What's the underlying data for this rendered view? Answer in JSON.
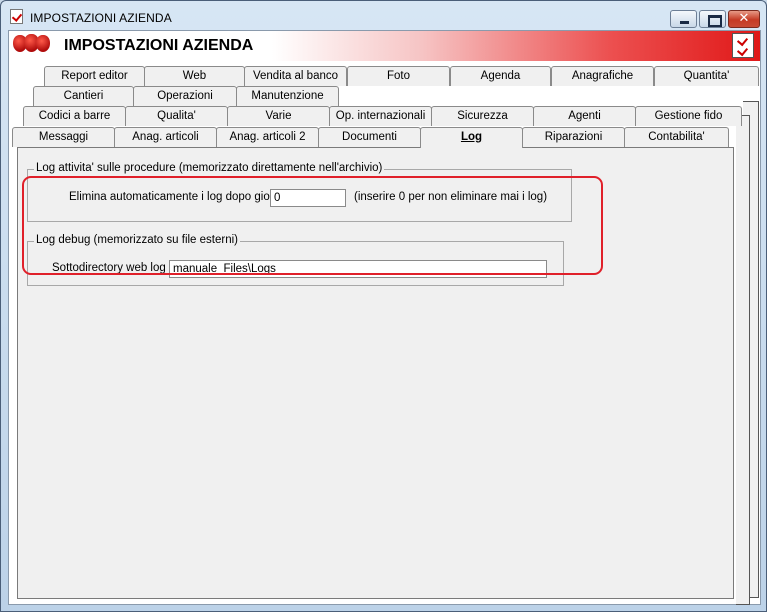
{
  "window": {
    "title": "IMPOSTAZIONI AZIENDA"
  },
  "banner": {
    "title": "IMPOSTAZIONI AZIENDA"
  },
  "tabs": {
    "row1": [
      "Report editor",
      "Web",
      "Vendita al banco",
      "Foto",
      "Agenda",
      "Anagrafiche",
      "Quantita'"
    ],
    "row2": [
      "Cantieri",
      "Operazioni",
      "Manutenzione"
    ],
    "row3": [
      "Codici a barre",
      "Qualita'",
      "Varie",
      "Op. internazionali",
      "Sicurezza",
      "Agenti",
      "Gestione fido"
    ],
    "row4": [
      "Messaggi",
      "Anag. articoli",
      "Anag. articoli 2",
      "Documenti",
      "Log",
      "Riparazioni",
      "Contabilita'"
    ],
    "active": "Log"
  },
  "log_group": {
    "legend": "Log attivita' sulle procedure (memorizzato direttamente nell'archivio)",
    "days_label": "Elimina automaticamente i log dopo giorni",
    "days_value": "0",
    "days_hint": "(inserire 0 per non eliminare mai i log)"
  },
  "debug_group": {
    "legend": "Log debug (memorizzato su file esterni)",
    "dir_label": "Sottodirectory web log :",
    "dir_value": "manuale_Files\\Logs"
  },
  "colors": {
    "highlight": "#e0202a",
    "banner_gradient_end": "#e01818"
  }
}
